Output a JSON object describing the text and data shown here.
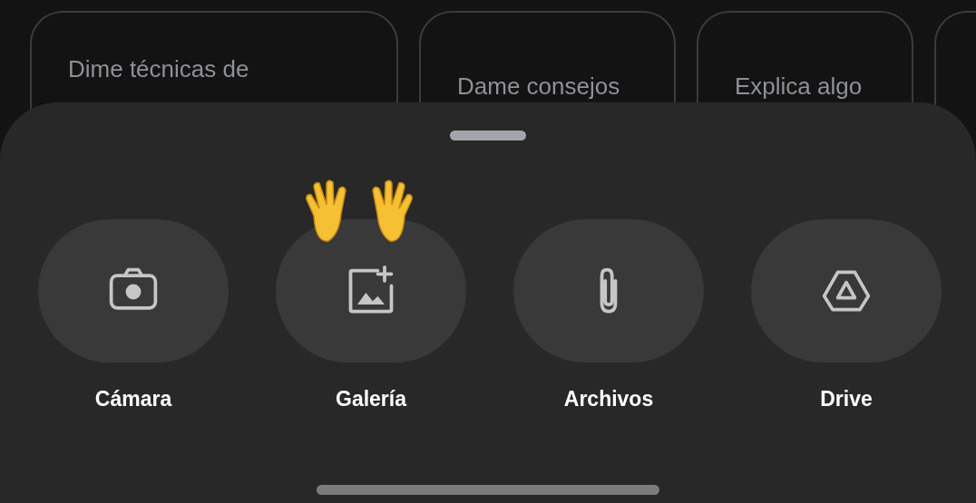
{
  "suggestions": [
    {
      "text": "Dime técnicas de"
    },
    {
      "text": "Dame consejos"
    },
    {
      "text": "Explica algo"
    }
  ],
  "attach_sheet": {
    "options": [
      {
        "kind": "camera",
        "label": "Cámara"
      },
      {
        "kind": "gallery",
        "label": "Galería"
      },
      {
        "kind": "files",
        "label": "Archivos"
      },
      {
        "kind": "drive",
        "label": "Drive"
      }
    ]
  }
}
